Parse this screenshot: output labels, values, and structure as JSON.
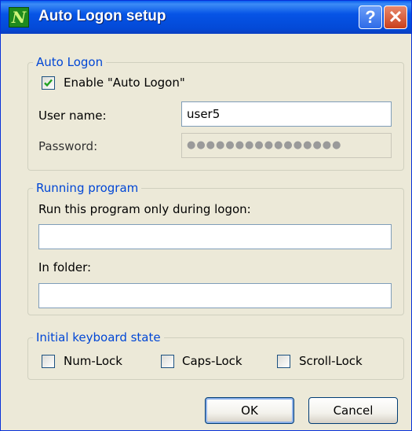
{
  "window": {
    "title": "Auto Logon setup",
    "icon_letter": "N",
    "help_glyph": "?",
    "close_glyph": "✕"
  },
  "auto_logon": {
    "legend": "Auto Logon",
    "enable_label": "Enable \"Auto Logon\"",
    "enable_checked": true,
    "username_label": "User name:",
    "username_value": "user5",
    "password_label": "Password:",
    "password_value": "●●●●●●●●●●●●●●●●"
  },
  "running_program": {
    "legend": "Running program",
    "program_label": "Run this program only during logon:",
    "program_value": "",
    "folder_label": "In folder:",
    "folder_value": ""
  },
  "keyboard": {
    "legend": "Initial keyboard state",
    "numlock_label": "Num-Lock",
    "capslock_label": "Caps-Lock",
    "scrolllock_label": "Scroll-Lock",
    "numlock_checked": false,
    "capslock_checked": false,
    "scrolllock_checked": false
  },
  "buttons": {
    "ok_label": "OK",
    "cancel_label": "Cancel"
  },
  "colors": {
    "title_bar": "#0654E6",
    "group_legend": "#0046D5",
    "dialog_bg": "#ECE9D8",
    "checkmark": "#21A121"
  }
}
